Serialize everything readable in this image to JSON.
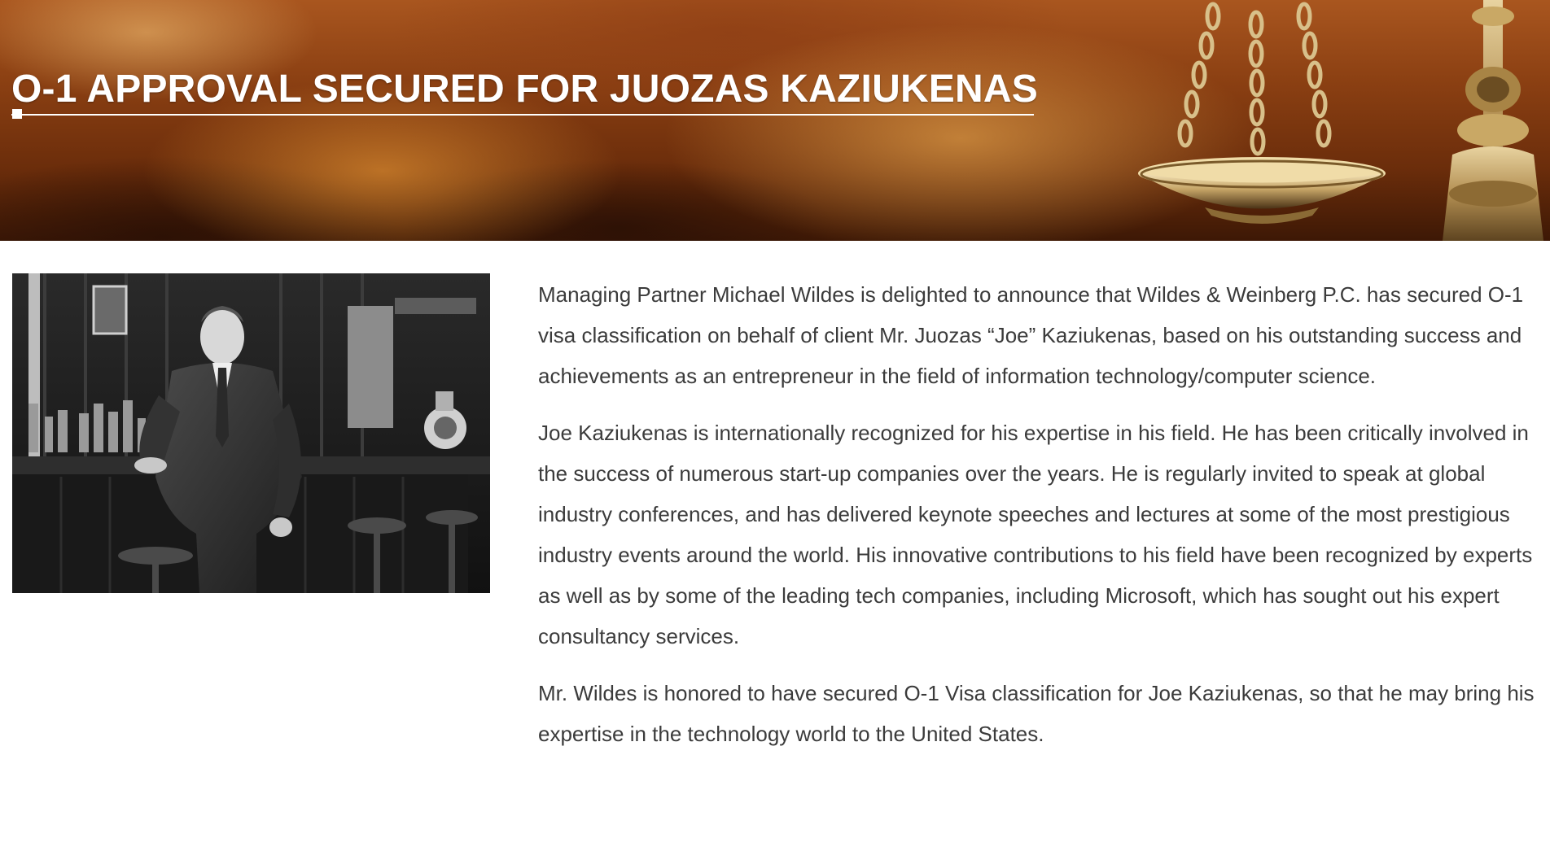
{
  "banner": {
    "title": "O-1 APPROVAL SECURED FOR JUOZAS KAZIUKENAS",
    "image_icon": "scales-of-justice-icon"
  },
  "photo": {
    "icon": "portrait-photo"
  },
  "article": {
    "paragraphs": [
      "Managing Partner Michael Wildes is delighted to announce that Wildes & Weinberg P.C. has secured O-1 visa classification on behalf of client Mr. Juozas “Joe” Kaziukenas, based on his outstanding success and achievements as an entrepreneur in the field of information technology/computer science.",
      "Joe Kaziukenas is internationally recognized for his expertise in his field. He has been critically involved in the success of numerous start-up companies over the years. He is regularly invited to speak at global industry conferences, and has delivered keynote speeches and lectures at some of the most prestigious industry events around the world. His innovative contributions to his field have been recognized by experts as well as by some of the leading tech companies, including Microsoft, which has sought out his expert consultancy services.",
      "Mr. Wildes is honored to have secured O-1 Visa classification for Joe Kaziukenas, so that he may bring his expertise in the technology world to the United States."
    ]
  },
  "colors": {
    "banner_dark": "#3d1805",
    "banner_light": "#a9561f",
    "title_text": "#ffffff",
    "body_text": "#3b3b3b"
  }
}
